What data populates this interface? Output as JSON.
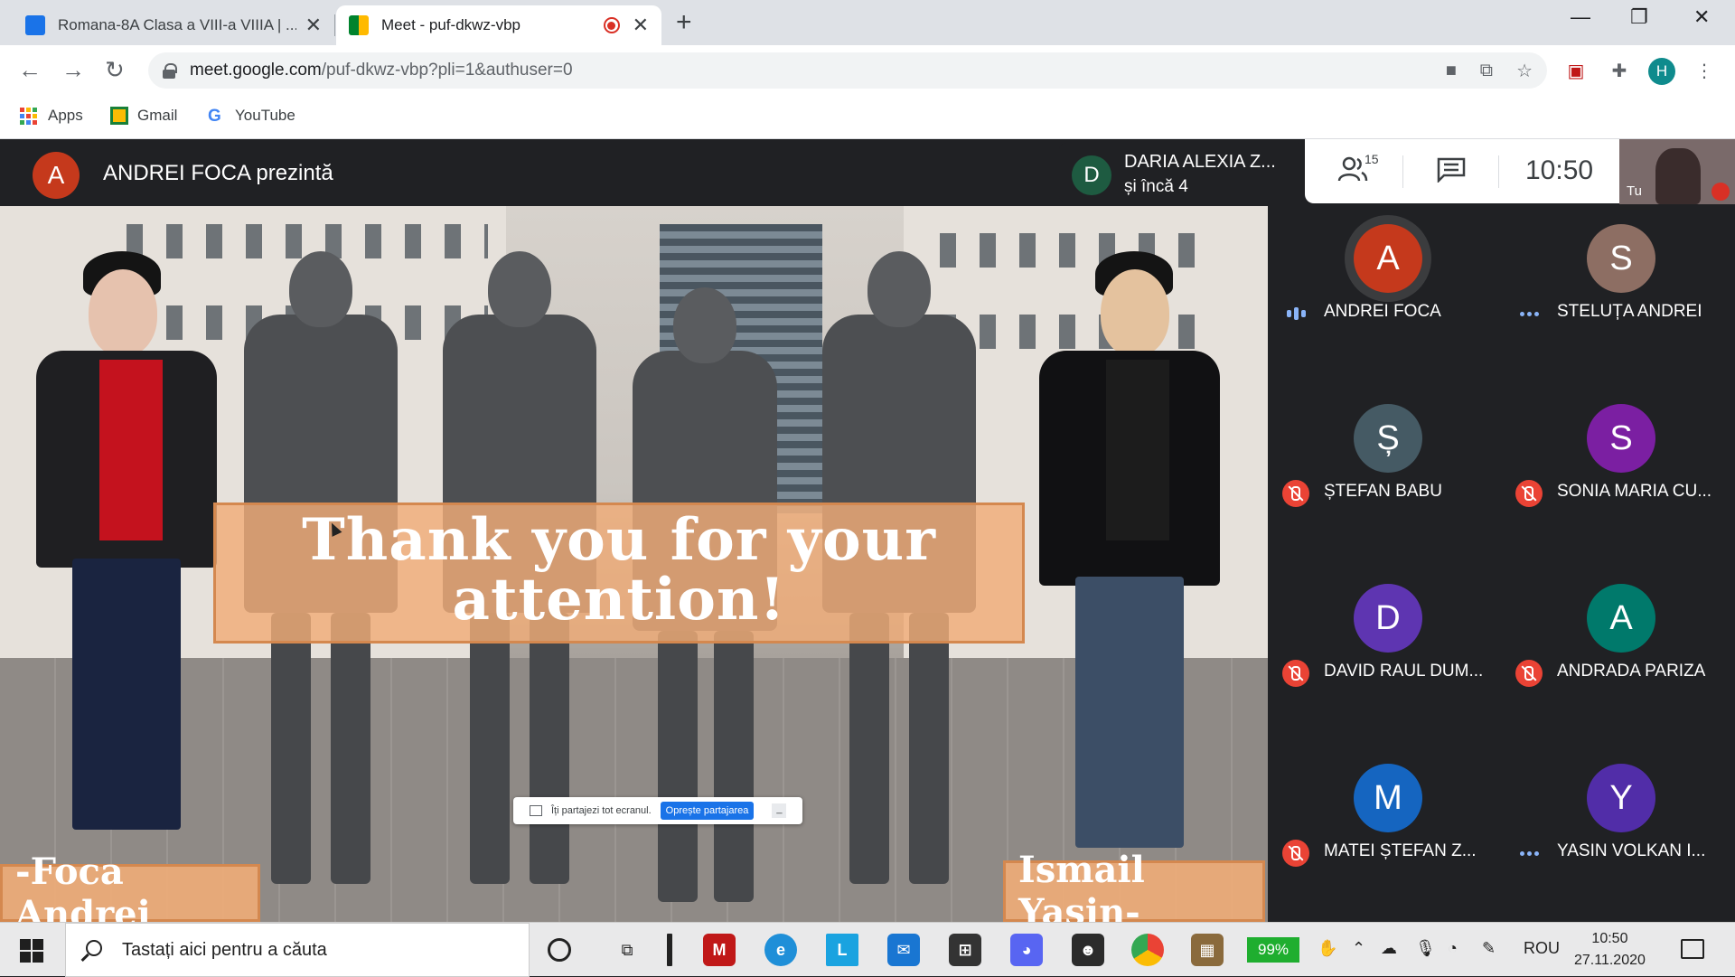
{
  "browser": {
    "tabs": [
      {
        "title": "Romana-8A Clasa a VIII-a VIIIA | ...",
        "active": false
      },
      {
        "title": "Meet - puf-dkwz-vbp",
        "active": true,
        "recording": true
      }
    ],
    "new_tab": "+",
    "window_controls": {
      "minimize": "—",
      "restore": "❐",
      "close": "✕"
    },
    "url": {
      "host": "meet.google.com",
      "path": "/puf-dkwz-vbp?pli=1&authuser=0"
    },
    "profile_initial": "H",
    "bookmarks": [
      {
        "label": "Apps",
        "icon": "apps-grid-icon"
      },
      {
        "label": "Gmail",
        "icon": "gmail-icon"
      },
      {
        "label": "YouTube",
        "icon": "google-g-icon"
      }
    ]
  },
  "meet": {
    "presenter": {
      "initial": "A",
      "text": "ANDREI FOCA prezintă",
      "color": "#c5391c"
    },
    "pinned": {
      "initial": "D",
      "line1": "DARIA ALEXIA Z...",
      "line2": "și încă 4",
      "color": "#1e5b41"
    },
    "participant_count": "15",
    "time": "10:50",
    "self_label": "Tu",
    "presentation": {
      "headline": "Thank you for your attention!",
      "left_caption": "-Foca Andrei",
      "right_caption": "Ismail Yasin-",
      "share_bar": {
        "text": "Îți partajezi tot ecranul.",
        "stop_label": "Oprește partajarea",
        "hide_label": "_"
      }
    },
    "participants": [
      {
        "initial": "A",
        "name": "ANDREI FOCA",
        "color": "#c5391c",
        "state": "speaking"
      },
      {
        "initial": "S",
        "name": "STELUȚA ANDREI",
        "color": "#8d6e63",
        "state": "dots"
      },
      {
        "initial": "Ș",
        "name": "ȘTEFAN BABU",
        "color": "#455a64",
        "state": "muted"
      },
      {
        "initial": "S",
        "name": "SONIA MARIA CU...",
        "color": "#7b1fa2",
        "state": "muted"
      },
      {
        "initial": "D",
        "name": "DAVID RAUL DUM...",
        "color": "#5e35b1",
        "state": "muted"
      },
      {
        "initial": "A",
        "name": "ANDRADA PARIZA",
        "color": "#00796b",
        "state": "muted"
      },
      {
        "initial": "M",
        "name": "MATEI ȘTEFAN Z...",
        "color": "#1565c0",
        "state": "muted"
      },
      {
        "initial": "Y",
        "name": "YASIN VOLKAN I...",
        "color": "#512da8",
        "state": "dots"
      }
    ]
  },
  "taskbar": {
    "search_placeholder": "Tastați aici pentru a căuta",
    "battery": "99%",
    "language": "ROU",
    "time": "10:50",
    "date": "27.11.2020"
  }
}
